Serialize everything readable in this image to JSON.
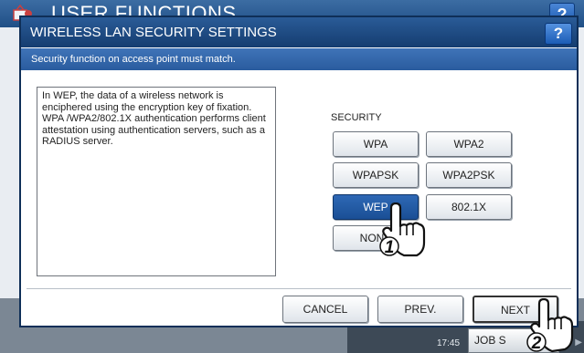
{
  "background": {
    "title": "USER FUNCTIONS",
    "help_label": "?",
    "time": "17:45",
    "job_status_label": "JOB S"
  },
  "dialog": {
    "title": "WIRELESS LAN SECURITY SETTINGS",
    "help_label": "?",
    "message": "Security function on access point must match.",
    "info_text": "In WEP, the data of a wireless network is enciphered using the encryption key of fixation. WPA /WPA2/802.1X authentication performs client attestation using authentication servers, such as a RADIUS server.",
    "security_label": "SECURITY",
    "security_options": [
      {
        "label": "WPA",
        "selected": false
      },
      {
        "label": "WPA2",
        "selected": false
      },
      {
        "label": "WPAPSK",
        "selected": false
      },
      {
        "label": "WPA2PSK",
        "selected": false
      },
      {
        "label": "WEP",
        "selected": true
      },
      {
        "label": "802.1X",
        "selected": false
      },
      {
        "label": "NONE",
        "selected": false
      }
    ],
    "buttons": {
      "cancel": "CANCEL",
      "prev": "PREV.",
      "next": "NEXT"
    }
  },
  "callouts": {
    "step1": "1",
    "step2": "2"
  },
  "colors": {
    "title_bar": "#1f4f86",
    "selected_button": "#1a4f95",
    "message_bar": "#2a5c9e"
  }
}
